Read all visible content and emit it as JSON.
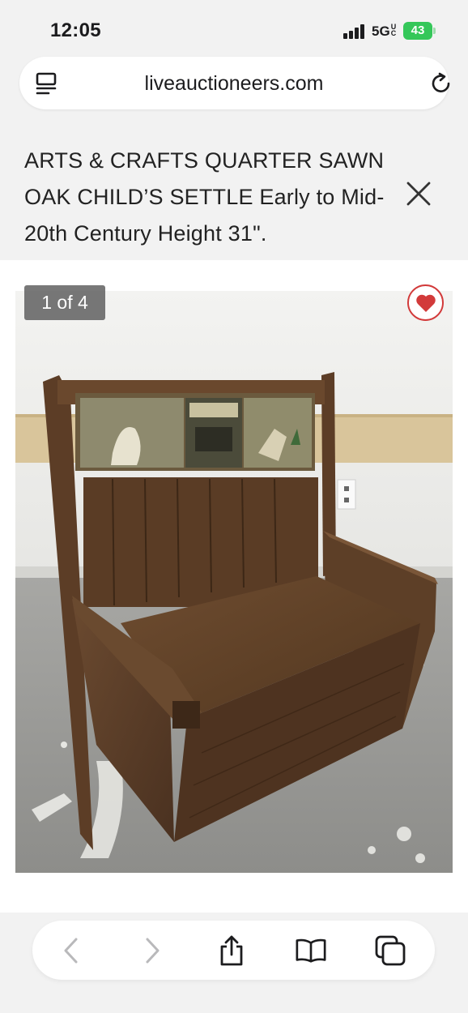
{
  "status_bar": {
    "time": "12:05",
    "network": "5G",
    "network_suffix": "UC",
    "battery": "43"
  },
  "browser": {
    "url": "liveauctioneers.com",
    "reader_icon": "reader-mode-icon",
    "reload_icon": "reload-icon"
  },
  "listing": {
    "title": "ARTS & CRAFTS QUARTER SAWN OAK CHILD’S SETTLE Early to Mid-20th Century Height 31\".",
    "close_icon": "close-icon"
  },
  "gallery": {
    "counter": "1 of 4",
    "favorite_icon": "heart-icon",
    "colors": {
      "heart": "#d23a3a"
    }
  },
  "toolbar": {
    "back_icon": "chevron-left-icon",
    "forward_icon": "chevron-right-icon",
    "share_icon": "share-icon",
    "bookmarks_icon": "book-icon",
    "tabs_icon": "tabs-icon"
  }
}
